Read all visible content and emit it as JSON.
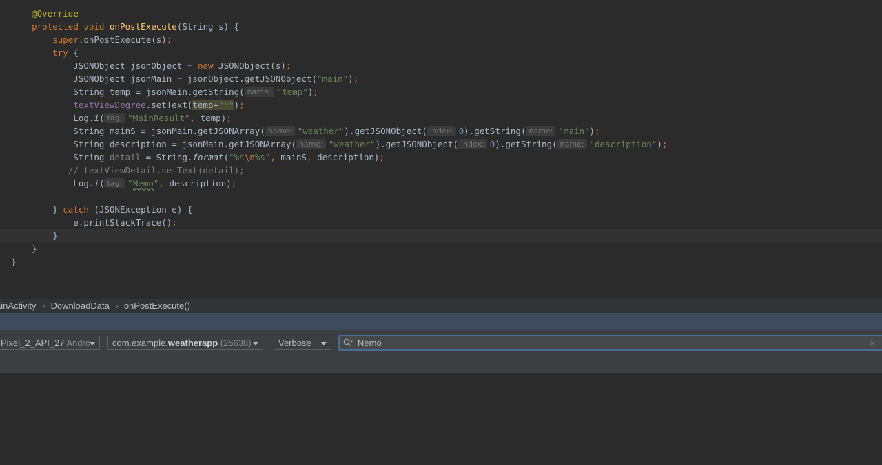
{
  "editor": {
    "lines": [
      [
        {
          "t": "    "
        },
        {
          "t": "@Override",
          "c": "ann"
        }
      ],
      [
        {
          "t": "    "
        },
        {
          "t": "protected void ",
          "c": "kw"
        },
        {
          "t": "onPostExecute",
          "c": "fn"
        },
        {
          "t": "(String s) {"
        }
      ],
      [
        {
          "t": "        "
        },
        {
          "t": "super",
          "c": "kw"
        },
        {
          "t": ".onPostExecute(s)"
        },
        {
          "t": ";",
          "c": "kw"
        }
      ],
      [
        {
          "t": "        "
        },
        {
          "t": "try ",
          "c": "kw"
        },
        {
          "t": "{"
        }
      ],
      [
        {
          "t": "            JSONObject jsonObject = "
        },
        {
          "t": "new ",
          "c": "kw"
        },
        {
          "t": "JSONObject(s)"
        },
        {
          "t": ";",
          "c": "kw"
        }
      ],
      [
        {
          "t": "            JSONObject jsonMain = jsonObject.getJSONObject("
        },
        {
          "t": "\"main\"",
          "c": "str"
        },
        {
          "t": ")"
        },
        {
          "t": ";",
          "c": "kw"
        }
      ],
      [
        {
          "t": "            String temp = jsonMain.getString("
        },
        {
          "h": "name:"
        },
        {
          "t": "\"temp\"",
          "c": "str"
        },
        {
          "t": ")"
        },
        {
          "t": ";",
          "c": "kw"
        }
      ],
      [
        {
          "t": "            "
        },
        {
          "t": "textViewDegree",
          "c": "field"
        },
        {
          "t": ".setText("
        },
        {
          "t": "temp+",
          "c": "hl"
        },
        {
          "t": "\"°\"",
          "c": "str hl"
        },
        {
          "t": ")"
        },
        {
          "t": ";",
          "c": "kw"
        }
      ],
      [
        {
          "t": "            Log."
        },
        {
          "t": "i",
          "c": "it"
        },
        {
          "t": "("
        },
        {
          "h": "tag:"
        },
        {
          "t": "\"MainResult\"",
          "c": "str"
        },
        {
          "t": ", ",
          "c": "kw"
        },
        {
          "t": "temp)"
        },
        {
          "t": ";",
          "c": "kw"
        }
      ],
      [
        {
          "t": "            String mainS = jsonMain.getJSONArray("
        },
        {
          "h": "name:"
        },
        {
          "t": "\"weather\"",
          "c": "str"
        },
        {
          "t": ").getJSONObject("
        },
        {
          "h": "index:"
        },
        {
          "t": "0",
          "c": "num"
        },
        {
          "t": ").getString("
        },
        {
          "h": "name:"
        },
        {
          "t": "\"main\"",
          "c": "str"
        },
        {
          "t": ")"
        },
        {
          "t": ";",
          "c": "kw"
        }
      ],
      [
        {
          "t": "            String description = jsonMain.getJSONArray("
        },
        {
          "h": "name:"
        },
        {
          "t": "\"weather\"",
          "c": "str"
        },
        {
          "t": ").getJSONObject("
        },
        {
          "h": "index:"
        },
        {
          "t": "0",
          "c": "num"
        },
        {
          "t": ").getString("
        },
        {
          "h": "name:"
        },
        {
          "t": "\"description\"",
          "c": "str"
        },
        {
          "t": ")"
        },
        {
          "t": ";",
          "c": "kw"
        }
      ],
      [
        {
          "t": "            String "
        },
        {
          "t": "detail",
          "c": "cmt"
        },
        {
          "t": " = String."
        },
        {
          "t": "format",
          "c": "it"
        },
        {
          "t": "("
        },
        {
          "t": "\"%s",
          "c": "str"
        },
        {
          "t": "\\n",
          "c": "kw"
        },
        {
          "t": "%s\"",
          "c": "str"
        },
        {
          "t": ", ",
          "c": "kw"
        },
        {
          "t": "mainS"
        },
        {
          "t": ", ",
          "c": "kw"
        },
        {
          "t": "description)"
        },
        {
          "t": ";",
          "c": "kw"
        }
      ],
      [
        {
          "t": "           "
        },
        {
          "t": "// textViewDetail.setText(detail);",
          "c": "cmt"
        }
      ],
      [
        {
          "t": "            Log."
        },
        {
          "t": "i",
          "c": "it"
        },
        {
          "t": "("
        },
        {
          "h": "tag:"
        },
        {
          "t": "\"",
          "c": "str"
        },
        {
          "t": "Nemo",
          "c": "str typo"
        },
        {
          "t": "\"",
          "c": "str"
        },
        {
          "t": ", ",
          "c": "kw"
        },
        {
          "t": "description)"
        },
        {
          "t": ";",
          "c": "kw"
        }
      ],
      [
        {
          "t": ""
        }
      ],
      [
        {
          "t": "        } "
        },
        {
          "t": "catch ",
          "c": "kw"
        },
        {
          "t": "(JSONException e) {"
        }
      ],
      [
        {
          "t": "            e.printStackTrace()"
        },
        {
          "t": ";",
          "c": "kw"
        }
      ],
      [
        {
          "t": "        }"
        }
      ],
      [
        {
          "t": "    }"
        }
      ],
      [
        {
          "t": "}"
        }
      ]
    ]
  },
  "breadcrumb": {
    "items": [
      "ainActivity",
      "DownloadData",
      "onPostExecute()"
    ],
    "separator": "›"
  },
  "logcat": {
    "device": {
      "name": "Pixel_2_API_27",
      "suffix": "Andro"
    },
    "process": {
      "prefix": "com.example.",
      "app": "weatherapp",
      "pid": "(26638)"
    },
    "level": "Verbose",
    "search_value": "Nemo",
    "clear_icon": "×"
  },
  "colors": {
    "editor_bg": "#2b2b2b",
    "keyword": "#cc7832",
    "string": "#6a8759",
    "method": "#ffc66d",
    "annotation": "#bbb529",
    "field": "#9876aa",
    "number": "#6897bb",
    "comment": "#808080",
    "text": "#a9b7c6",
    "logcat_header": "#3d4b5c",
    "search_focus": "#466d94"
  }
}
